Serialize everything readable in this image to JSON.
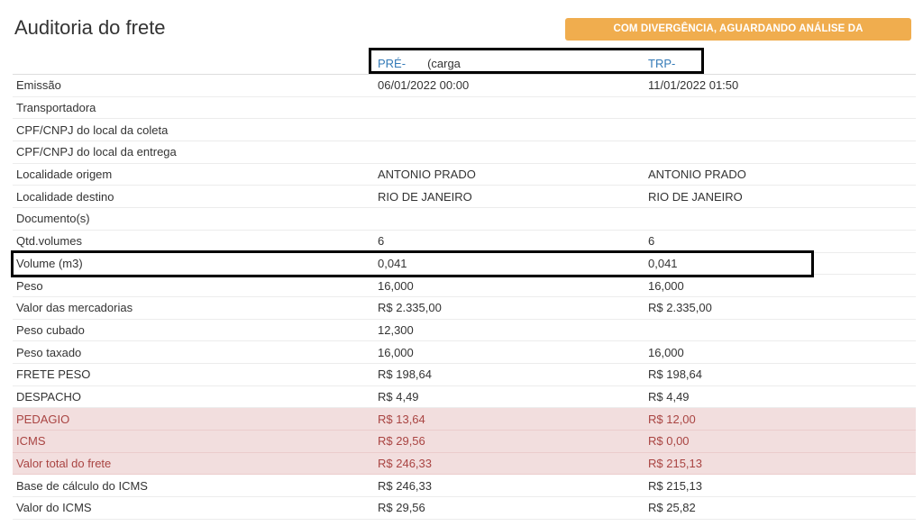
{
  "title": "Auditoria do frete",
  "status_badge": "COM DIVERGÊNCIA, AGUARDANDO ANÁLISE DA TRANSPORTADORA",
  "columns": {
    "pre_prefix": "PRÉ-",
    "pre_suffix": "(carga",
    "trp": "TRP-"
  },
  "rows": [
    {
      "label": "Emissão",
      "pre": "06/01/2022 00:00",
      "trp": "11/01/2022 01:50"
    },
    {
      "label": "Transportadora",
      "pre": "",
      "trp": ""
    },
    {
      "label": "CPF/CNPJ do local da coleta",
      "pre": "",
      "trp": ""
    },
    {
      "label": "CPF/CNPJ do local da entrega",
      "pre": "",
      "trp": ""
    },
    {
      "label": "Localidade origem",
      "pre": "ANTONIO PRADO",
      "trp": "ANTONIO PRADO"
    },
    {
      "label": "Localidade destino",
      "pre": "RIO DE JANEIRO",
      "trp": "RIO DE JANEIRO"
    },
    {
      "label": "Documento(s)",
      "pre": "",
      "trp": ""
    },
    {
      "label": "Qtd.volumes",
      "pre": "6",
      "trp": "6"
    },
    {
      "label": "Volume (m3)",
      "pre": "0,041",
      "trp": "0,041"
    },
    {
      "label": "Peso",
      "pre": "16,000",
      "trp": "16,000"
    },
    {
      "label": "Valor das mercadorias",
      "pre": "R$ 2.335,00",
      "trp": "R$ 2.335,00"
    },
    {
      "label": "Peso cubado",
      "pre": "12,300",
      "trp": ""
    },
    {
      "label": "Peso taxado",
      "pre": "16,000",
      "trp": "16,000"
    },
    {
      "label": "FRETE PESO",
      "pre": "R$ 198,64",
      "trp": "R$ 198,64"
    },
    {
      "label": "DESPACHO",
      "pre": "R$ 4,49",
      "trp": "R$ 4,49"
    },
    {
      "label": "PEDAGIO",
      "pre": "R$ 13,64",
      "trp": "R$ 12,00"
    },
    {
      "label": "ICMS",
      "pre": "R$ 29,56",
      "trp": "R$ 0,00"
    },
    {
      "label": "Valor total do frete",
      "pre": "R$ 246,33",
      "trp": "R$ 215,13"
    },
    {
      "label": "Base de cálculo do ICMS",
      "pre": "R$ 246,33",
      "trp": "R$ 215,13"
    },
    {
      "label": "Valor do ICMS",
      "pre": "R$ 29,56",
      "trp": "R$ 25,82"
    }
  ]
}
